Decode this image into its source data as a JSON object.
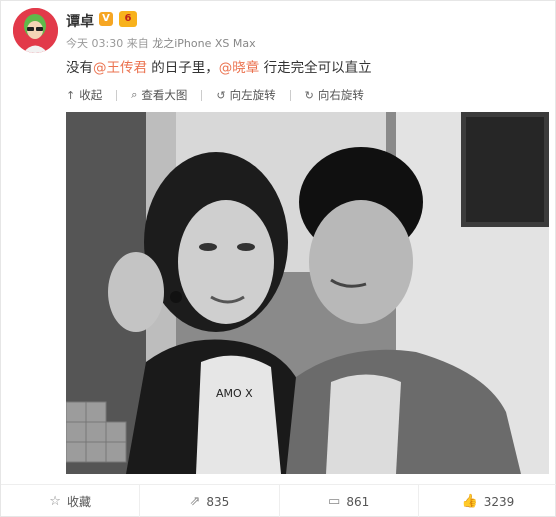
{
  "post": {
    "username": "谭卓",
    "verified_badge": "V",
    "level_badge": "6",
    "time": "今天 03:30",
    "source_prefix": "来自",
    "source": "龙之iPhone XS Max",
    "text_before": "没有",
    "mention1": "@王传君",
    "text_middle": " 的日子里，",
    "mention2": "@晓章",
    "text_after": " 行走完全可以直立"
  },
  "media_toolbar": {
    "collapse": "收起",
    "view_large": "查看大图",
    "rotate_left": "向左旋转",
    "rotate_right": "向右旋转"
  },
  "photo": {
    "shirt_text": "AMO X"
  },
  "actions": {
    "favorite": "收藏",
    "repost": "835",
    "comment": "861",
    "like": "3239"
  },
  "icons": {
    "collapse": "collapse-icon",
    "view_large": "magnifier-icon",
    "rotate_left": "rotate-left-icon",
    "rotate_right": "rotate-right-icon",
    "favorite": "star-icon",
    "repost": "repost-icon",
    "comment": "comment-icon",
    "like": "thumbs-up-icon"
  },
  "colors": {
    "mention": "#eb7350",
    "avatar_bg": "#e23a4a",
    "verified": "#f6a623"
  }
}
